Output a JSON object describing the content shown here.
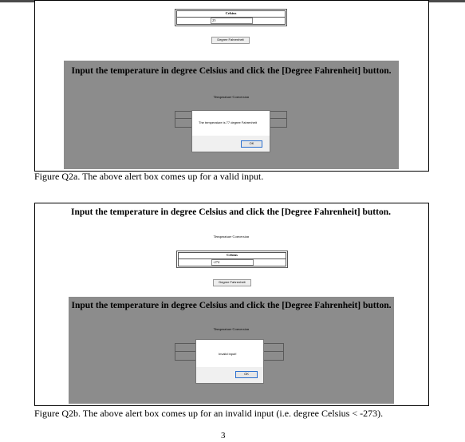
{
  "figure_a": {
    "celsius_label": "Celsius",
    "celsius_value": "25",
    "button_label": "Degree Fahrenheit",
    "instruction": "Input the temperature in degree Celsius and click the [Degree Fahrenheit] button.",
    "subtitle": "Temperature Conversion",
    "alert_message": "The temperature is 77 degree Fahrenheit",
    "ok_label": "OK",
    "caption": "Figure Q2a. The above alert box comes up for a valid input."
  },
  "figure_b": {
    "instruction": "Input the temperature in degree Celsius and click the [Degree Fahrenheit] button.",
    "subtitle": "Temperature Conversion",
    "celsius_label": "Celsius",
    "celsius_value": "-274",
    "button_label": "Degree Fahrenheit",
    "overlay_instruction": "Input the temperature in degree Celsius and click the [Degree Fahrenheit] button.",
    "overlay_subtitle": "Temperature Conversion",
    "alert_message": "Invalid input!",
    "ok_label": "OK",
    "caption": "Figure Q2b. The above alert box comes up for an invalid input (i.e. degree Celsius < -273)."
  },
  "page_number": "3"
}
